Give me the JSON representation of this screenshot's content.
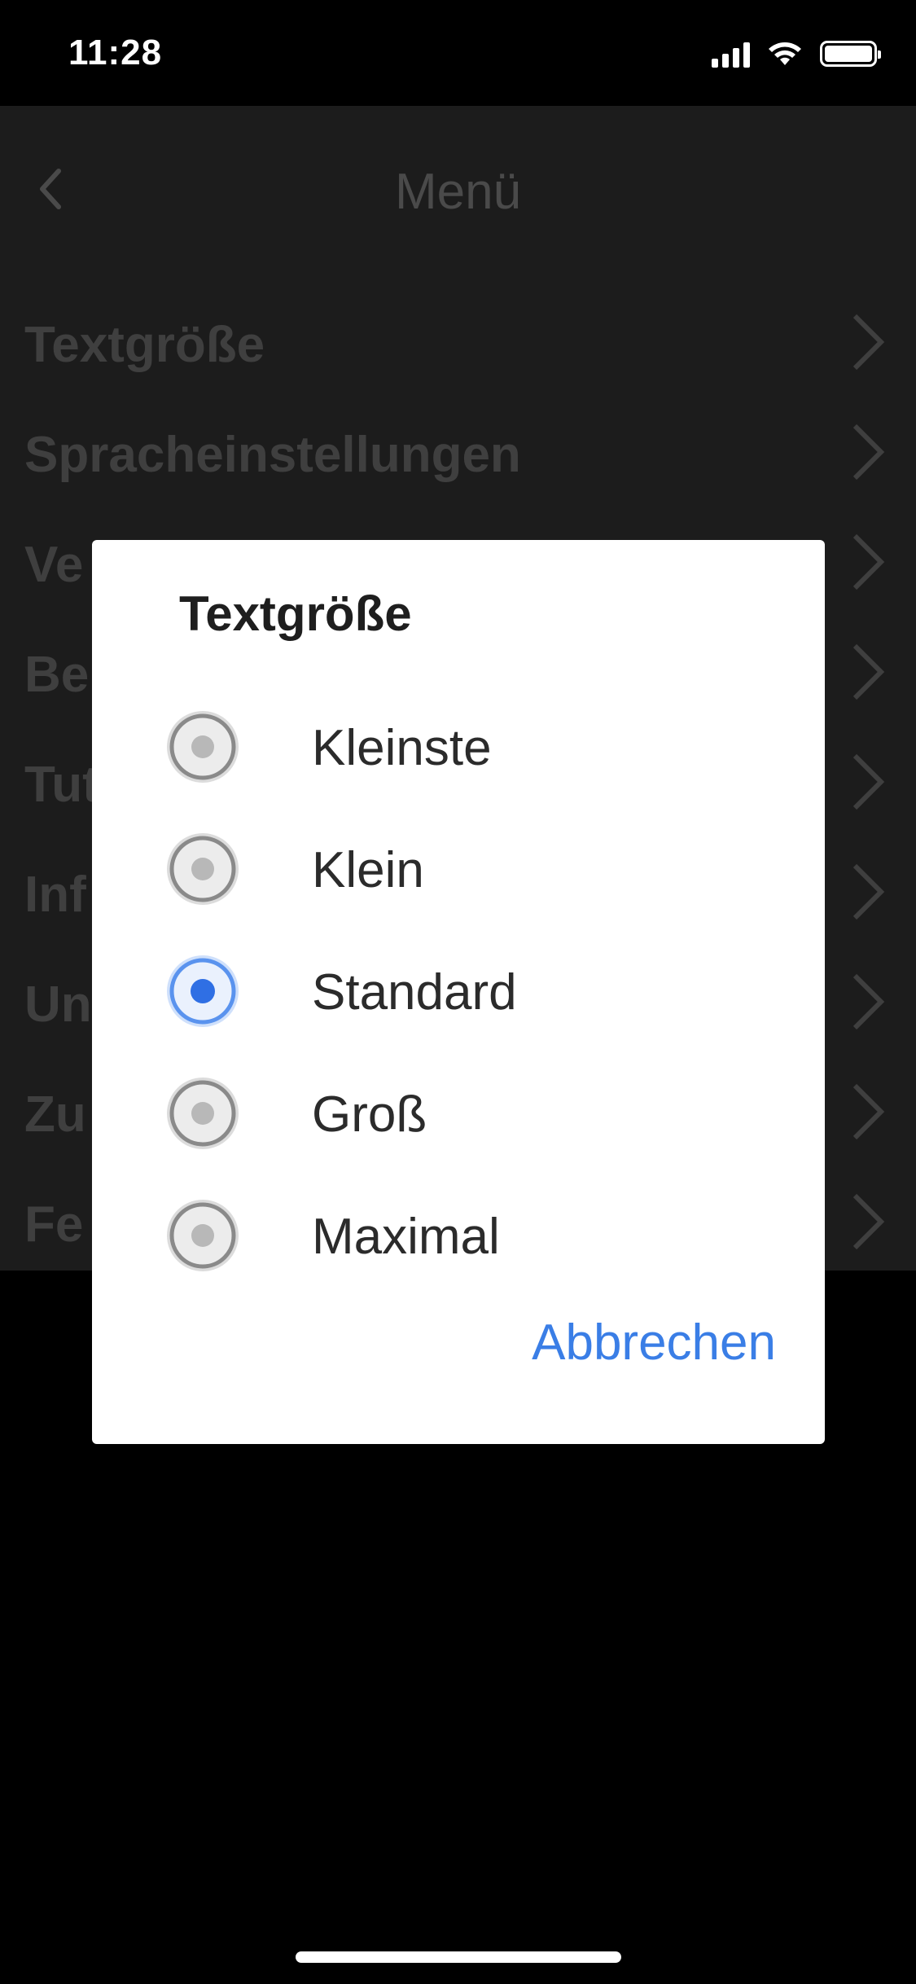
{
  "status_bar": {
    "time": "11:28"
  },
  "nav": {
    "back_icon": "chevron-left-icon",
    "title": "Menü"
  },
  "menu": {
    "items": [
      {
        "label": "Textgröße"
      },
      {
        "label": "Spracheinstellungen"
      },
      {
        "label": "Ve"
      },
      {
        "label": "Be"
      },
      {
        "label": "Tut"
      },
      {
        "label": "Inf"
      },
      {
        "label": "Un"
      },
      {
        "label": "Zu"
      },
      {
        "label": "Fe"
      }
    ]
  },
  "dialog": {
    "title": "Textgröße",
    "options": [
      {
        "label": "Kleinste",
        "selected": false
      },
      {
        "label": "Klein",
        "selected": false
      },
      {
        "label": "Standard",
        "selected": true
      },
      {
        "label": "Groß",
        "selected": false
      },
      {
        "label": "Maximal",
        "selected": false
      }
    ],
    "cancel_label": "Abbrechen"
  },
  "colors": {
    "accent": "#3a7ee6",
    "background": "#000000",
    "dimmed_screen": "#1c1c1c"
  }
}
